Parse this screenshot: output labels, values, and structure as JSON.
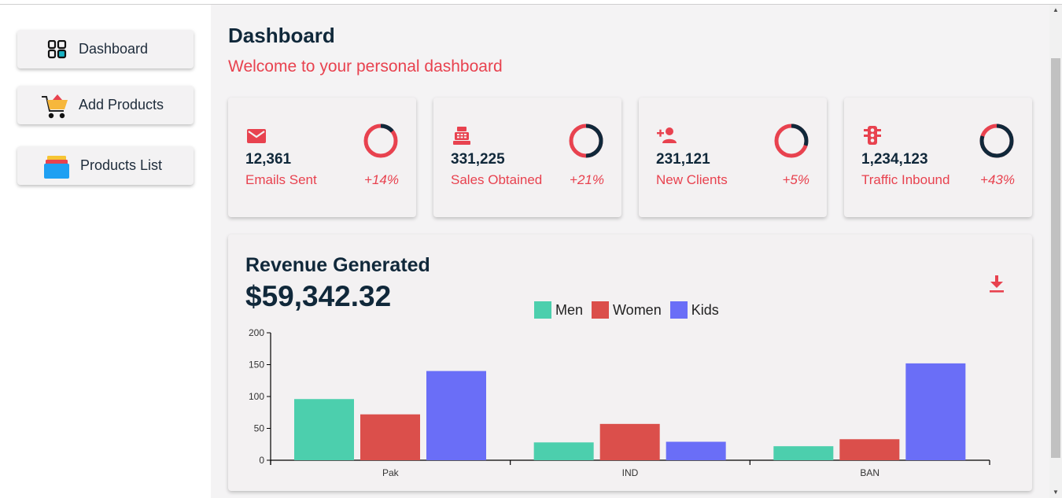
{
  "sidebar": {
    "items": [
      {
        "label": "Dashboard",
        "icon": "dashboard-grid-icon"
      },
      {
        "label": "Add Products",
        "icon": "shopping-cart-icon"
      },
      {
        "label": "Products List",
        "icon": "stacked-boxes-icon"
      }
    ]
  },
  "header": {
    "title": "Dashboard",
    "subtitle": "Welcome to your personal dashboard"
  },
  "stats": [
    {
      "value": "12,361",
      "label": "Emails Sent",
      "change": "+14%",
      "progress": 0.14,
      "icon": "email-icon"
    },
    {
      "value": "331,225",
      "label": "Sales Obtained",
      "change": "+21%",
      "progress": 0.5,
      "icon": "cash-register-icon"
    },
    {
      "value": "231,121",
      "label": "New Clients",
      "change": "+5%",
      "progress": 0.3,
      "icon": "add-person-icon"
    },
    {
      "value": "1,234,123",
      "label": "Traffic Inbound",
      "change": "+43%",
      "progress": 0.8,
      "icon": "traffic-light-icon"
    }
  ],
  "revenue": {
    "title": "Revenue Generated",
    "amount": "$59,342.32"
  },
  "colors": {
    "accent": "#e8424f",
    "dark": "#10283a",
    "men": "#4ccfad",
    "women": "#db4f4b",
    "kids": "#6a6ef7"
  },
  "chart_data": {
    "type": "bar",
    "categories": [
      "Pak",
      "IND",
      "BAN"
    ],
    "series": [
      {
        "name": "Men",
        "values": [
          96,
          28,
          22
        ]
      },
      {
        "name": "Women",
        "values": [
          72,
          57,
          33
        ]
      },
      {
        "name": "Kids",
        "values": [
          140,
          29,
          152
        ]
      }
    ],
    "yticks": [
      0,
      50,
      100,
      150,
      200
    ],
    "ylim": [
      0,
      200
    ],
    "legend": "top-center",
    "grid": false
  }
}
